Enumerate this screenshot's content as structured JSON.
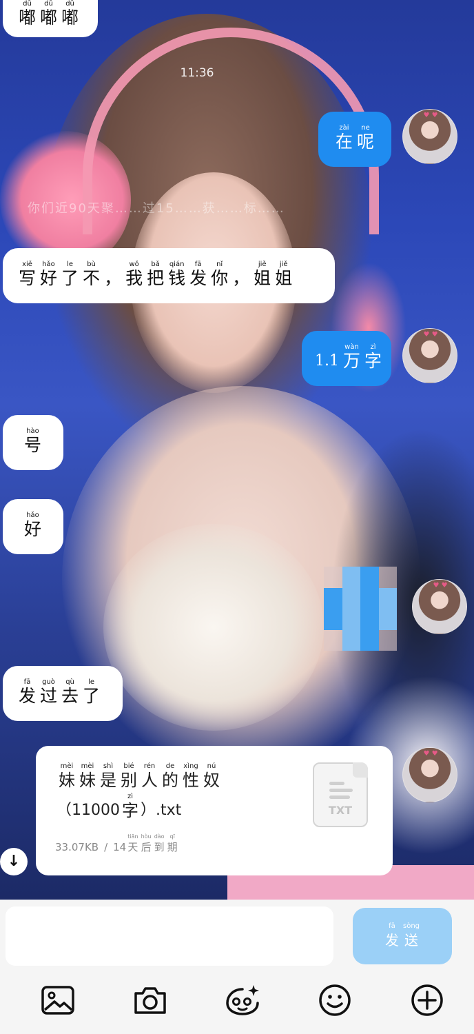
{
  "status": {
    "time": "11:36"
  },
  "system_note": "你们近90天聚……过15……获……标……",
  "messages": [
    {
      "side": "left",
      "label": "嘟嘟嘟",
      "chars": [
        {
          "py": "dū",
          "hz": "嘟"
        },
        {
          "py": "dū",
          "hz": "嘟"
        },
        {
          "py": "dū",
          "hz": "嘟"
        }
      ]
    },
    {
      "side": "right",
      "label": "在呢",
      "chars": [
        {
          "py": "zài",
          "hz": "在"
        },
        {
          "py": "ne",
          "hz": "呢"
        }
      ]
    },
    {
      "side": "left",
      "label": "写好了不，我把钱发你，姐姐",
      "chars": [
        {
          "py": "xiě",
          "hz": "写"
        },
        {
          "py": "hǎo",
          "hz": "好"
        },
        {
          "py": "le",
          "hz": "了"
        },
        {
          "py": "bù",
          "hz": "不"
        },
        {
          "py": "",
          "hz": "，"
        },
        {
          "py": "wǒ",
          "hz": "我"
        },
        {
          "py": "bǎ",
          "hz": "把"
        },
        {
          "py": "qián",
          "hz": "钱"
        },
        {
          "py": "fā",
          "hz": "发"
        },
        {
          "py": "nǐ",
          "hz": "你"
        },
        {
          "py": "",
          "hz": "，"
        },
        {
          "py": "jiě",
          "hz": "姐"
        },
        {
          "py": "jiě",
          "hz": "姐"
        }
      ]
    },
    {
      "side": "right",
      "label": "1.1万字",
      "chars": [
        {
          "py": "",
          "hz": "1.1"
        },
        {
          "py": "wàn",
          "hz": "万"
        },
        {
          "py": "zì",
          "hz": "字"
        }
      ]
    },
    {
      "side": "left",
      "label": "号",
      "chars": [
        {
          "py": "hào",
          "hz": "号"
        }
      ]
    },
    {
      "side": "left",
      "label": "好",
      "chars": [
        {
          "py": "hǎo",
          "hz": "好"
        }
      ]
    },
    {
      "side": "left",
      "label": "发过去了",
      "chars": [
        {
          "py": "fā",
          "hz": "发"
        },
        {
          "py": "guò",
          "hz": "过"
        },
        {
          "py": "qù",
          "hz": "去"
        },
        {
          "py": "le",
          "hz": "了"
        }
      ]
    }
  ],
  "file": {
    "name_chars": [
      {
        "py": "mèi",
        "hz": "妹"
      },
      {
        "py": "mèi",
        "hz": "妹"
      },
      {
        "py": "shì",
        "hz": "是"
      },
      {
        "py": "bié",
        "hz": "别"
      },
      {
        "py": "rén",
        "hz": "人"
      },
      {
        "py": "de",
        "hz": "的"
      },
      {
        "py": "xìng",
        "hz": "性"
      },
      {
        "py": "nú",
        "hz": "奴"
      }
    ],
    "name_line2_pre": "（11000",
    "name_line2_char": {
      "py": "zì",
      "hz": "字"
    },
    "name_line2_post": "）.txt",
    "size": "33.07KB",
    "separator": "/",
    "expiry_num": "14",
    "expiry_chars": [
      {
        "py": "tiān",
        "hz": "天"
      },
      {
        "py": "hòu",
        "hz": "后"
      },
      {
        "py": "dào",
        "hz": "到"
      },
      {
        "py": "qī",
        "hz": "期"
      }
    ],
    "icon_label": "TXT"
  },
  "input": {
    "placeholder": ""
  },
  "send_button": {
    "chars": [
      {
        "py": "fā",
        "hz": "发"
      },
      {
        "py": "sòng",
        "hz": "送"
      }
    ]
  },
  "toolbar": [
    "image-icon",
    "camera-icon",
    "sticker-icon",
    "emoji-icon",
    "plus-icon"
  ],
  "colors": {
    "accent": "#1f8cf0",
    "send_disabled": "#9bd0f7",
    "bar_bg": "#f5f5f5"
  }
}
